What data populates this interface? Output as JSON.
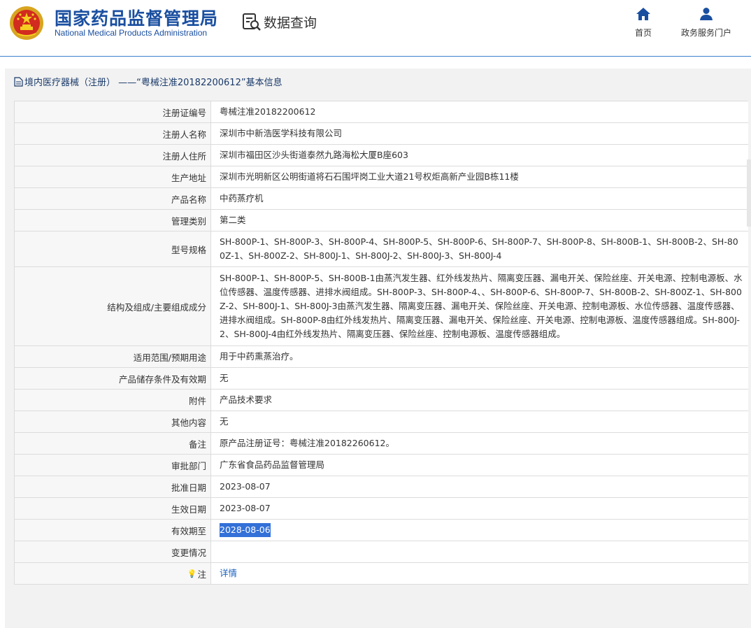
{
  "header": {
    "title_cn": "国家药品监督管理局",
    "title_en": "National Medical Products Administration",
    "query_label": "数据查询",
    "nav": [
      {
        "label": "首页",
        "icon": "home-icon"
      },
      {
        "label": "政务服务门户",
        "icon": "user-icon"
      }
    ]
  },
  "panel": {
    "title": "境内医疗器械（注册） ——“粤械注准20182200612”基本信息"
  },
  "rows": [
    {
      "label": "注册证编号",
      "value": "粤械注准20182200612"
    },
    {
      "label": "注册人名称",
      "value": "深圳市中新浩医学科技有限公司"
    },
    {
      "label": "注册人住所",
      "value": "深圳市福田区沙头街道泰然九路海松大厦B座603"
    },
    {
      "label": "生产地址",
      "value": "深圳市光明新区公明街道将石石围坪岗工业大道21号权炬高新产业园B栋11楼"
    },
    {
      "label": "产品名称",
      "value": "中药蒸疗机"
    },
    {
      "label": "管理类别",
      "value": "第二类"
    },
    {
      "label": "型号规格",
      "value": "SH-800P-1、SH-800P-3、SH-800P-4、SH-800P-5、SH-800P-6、SH-800P-7、SH-800P-8、SH-800B-1、SH-800B-2、SH-800Z-1、SH-800Z-2、SH-800J-1、SH-800J-2、SH-800J-3、SH-800J-4"
    },
    {
      "label": "结构及组成/主要组成成分",
      "value": "SH-800P-1、SH-800P-5、SH-800B-1由蒸汽发生器、红外线发热片、隔离变压器、漏电开关、保险丝座、开关电源、控制电源板、水位传感器、温度传感器、进排水阀组成。SH-800P-3、SH-800P-4、、SH-800P-6、SH-800P-7、SH-800B-2、SH-800Z-1、SH-800Z-2、SH-800J-1、SH-800J-3由蒸汽发生器、隔离变压器、漏电开关、保险丝座、开关电源、控制电源板、水位传感器、温度传感器、进排水阀组成。SH-800P-8由红外线发热片、隔离变压器、漏电开关、保险丝座、开关电源、控制电源板、温度传感器组成。SH-800J-2、SH-800J-4由红外线发热片、隔离变压器、保险丝座、控制电源板、温度传感器组成。"
    },
    {
      "label": "适用范围/预期用途",
      "value": "用于中药熏蒸治疗。"
    },
    {
      "label": "产品储存条件及有效期",
      "value": "无"
    },
    {
      "label": "附件",
      "value": "产品技术要求"
    },
    {
      "label": "其他内容",
      "value": "无"
    },
    {
      "label": "备注",
      "value": "原产品注册证号：粤械注准20182260612。"
    },
    {
      "label": "审批部门",
      "value": "广东省食品药品监督管理局"
    },
    {
      "label": "批准日期",
      "value": "2023-08-07"
    },
    {
      "label": "生效日期",
      "value": "2023-08-07"
    },
    {
      "label": "有效期至",
      "value": "2028-08-06"
    },
    {
      "label": "变更情况",
      "value": ""
    },
    {
      "label": "注",
      "value": "详情"
    }
  ]
}
